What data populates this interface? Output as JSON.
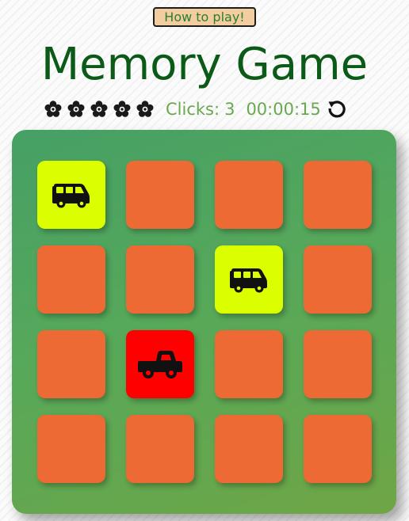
{
  "header": {
    "help_label": "How to play!",
    "title": "Memory Game"
  },
  "score_panel": {
    "stars": [
      "flower-icon",
      "flower-icon",
      "flower-icon",
      "flower-icon",
      "flower-icon"
    ],
    "clicks_label": "Clicks:",
    "clicks": "3",
    "timer": "00:00:15",
    "restart_icon": "restart-icon"
  },
  "board": {
    "rows": 4,
    "columns": 4,
    "cards": [
      {
        "state": "open",
        "icon": "van-icon"
      },
      {
        "state": "closed"
      },
      {
        "state": "closed"
      },
      {
        "state": "closed"
      },
      {
        "state": "closed"
      },
      {
        "state": "closed"
      },
      {
        "state": "open",
        "icon": "van-icon"
      },
      {
        "state": "closed"
      },
      {
        "state": "closed"
      },
      {
        "state": "wrong",
        "icon": "pickup-truck-icon"
      },
      {
        "state": "closed"
      },
      {
        "state": "closed"
      },
      {
        "state": "closed"
      },
      {
        "state": "closed"
      },
      {
        "state": "closed"
      },
      {
        "state": "closed"
      }
    ]
  },
  "colors": {
    "card_closed": "#ee6a35",
    "card_open": "#dcff00",
    "card_wrong": "#ff0000",
    "title": "#0b5a17",
    "score_text": "#6aa84f",
    "board_gradient_start": "#46a065",
    "board_gradient_end": "#6fa646"
  }
}
